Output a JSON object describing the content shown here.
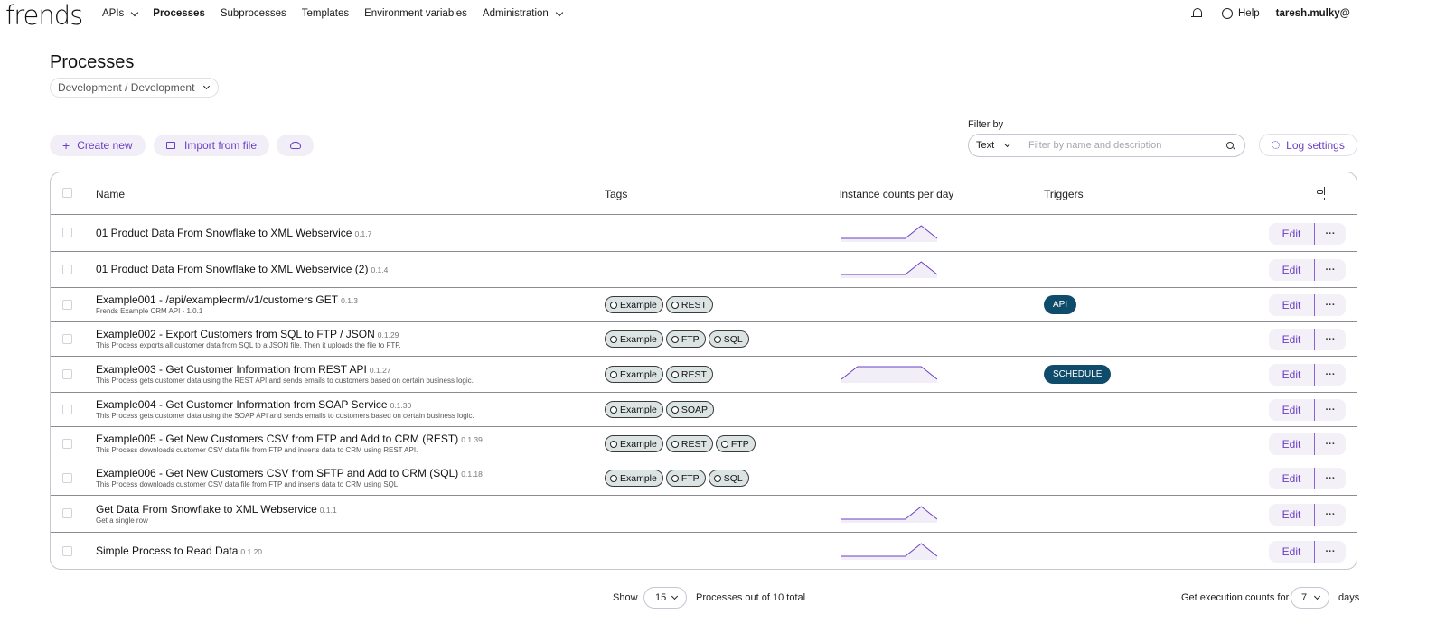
{
  "nav": {
    "logo": "frends",
    "items": [
      {
        "label": "APIs",
        "dropdown": true,
        "active": false
      },
      {
        "label": "Processes",
        "dropdown": false,
        "active": true
      },
      {
        "label": "Subprocesses",
        "dropdown": false,
        "active": false
      },
      {
        "label": "Templates",
        "dropdown": false,
        "active": false
      },
      {
        "label": "Environment variables",
        "dropdown": false,
        "active": false
      },
      {
        "label": "Administration",
        "dropdown": true,
        "active": false
      }
    ],
    "help_label": "Help",
    "user": "taresh.mulky@"
  },
  "page": {
    "title": "Processes",
    "environment": "Development / Development"
  },
  "actions": {
    "create_label": "Create new",
    "import_label": "Import from file"
  },
  "filter": {
    "label": "Filter by",
    "type": "Text",
    "placeholder": "Filter by name and description",
    "log_settings_label": "Log settings"
  },
  "table": {
    "columns": {
      "name": "Name",
      "tags": "Tags",
      "instances": "Instance counts per day",
      "triggers": "Triggers"
    },
    "edit_label": "Edit",
    "more_label": "···",
    "rows": [
      {
        "name": "01 Product Data From Snowflake to XML Webservice",
        "version": "0.1.7",
        "description": "",
        "tags": [],
        "spark": [
          0,
          0,
          0,
          0,
          0,
          1,
          0
        ],
        "trigger": ""
      },
      {
        "name": "01 Product Data From Snowflake to XML Webservice (2)",
        "version": "0.1.4",
        "description": "",
        "tags": [],
        "spark": [
          0,
          0,
          0,
          0,
          0,
          1,
          0
        ],
        "trigger": ""
      },
      {
        "name": "Example001 - /api/examplecrm/v1/customers GET",
        "version": "0.1.3",
        "description": "Frends Example CRM API - 1.0.1",
        "tags": [
          "Example",
          "REST"
        ],
        "spark": [],
        "trigger": "API"
      },
      {
        "name": "Example002 - Export Customers from SQL to FTP / JSON",
        "version": "0.1.29",
        "description": "This Process exports all customer data from SQL to a JSON file. Then it uploads the file to FTP.",
        "tags": [
          "Example",
          "FTP",
          "SQL"
        ],
        "spark": [],
        "trigger": ""
      },
      {
        "name": "Example003 - Get Customer Information from REST API",
        "version": "0.1.27",
        "description": "This Process gets customer data using the REST API and sends emails to customers based on certain business logic.",
        "tags": [
          "Example",
          "REST"
        ],
        "spark": [
          0,
          1,
          1,
          1,
          1,
          1,
          0
        ],
        "trigger": "SCHEDULE"
      },
      {
        "name": "Example004 - Get Customer Information from SOAP Service",
        "version": "0.1.30",
        "description": "This Process gets customer data using the SOAP API and sends emails to customers based on certain business logic.",
        "tags": [
          "Example",
          "SOAP"
        ],
        "spark": [],
        "trigger": ""
      },
      {
        "name": "Example005 - Get New Customers CSV from FTP and Add to CRM (REST)",
        "version": "0.1.39",
        "description": "This Process downloads customer CSV data file from FTP and inserts data to CRM using REST API.",
        "tags": [
          "Example",
          "REST",
          "FTP"
        ],
        "spark": [],
        "trigger": ""
      },
      {
        "name": "Example006 - Get New Customers CSV from SFTP and Add to CRM (SQL)",
        "version": "0.1.18",
        "description": "This Process downloads customer CSV data file from FTP and inserts data to CRM using SQL.",
        "tags": [
          "Example",
          "FTP",
          "SQL"
        ],
        "spark": [],
        "trigger": ""
      },
      {
        "name": "Get Data From Snowflake  to XML Webservice",
        "version": "0.1.1",
        "description": "Get a single row",
        "tags": [],
        "spark": [
          0,
          0,
          0,
          0,
          0,
          1,
          0
        ],
        "trigger": ""
      },
      {
        "name": "Simple Process to Read Data",
        "version": "0.1.20",
        "description": "",
        "tags": [],
        "spark": [
          0,
          0,
          0,
          0,
          0,
          1,
          0
        ],
        "trigger": ""
      }
    ]
  },
  "footer": {
    "show_label": "Show",
    "page_size": "15",
    "count_text": "Processes out of 10 total",
    "exec_label": "Get execution counts for",
    "days_value": "7",
    "days_label": "days"
  },
  "colors": {
    "accent": "#6b3fc4",
    "trigger_bg": "#0f4c6b",
    "spark_line": "#6b3fc4",
    "tag_bg": "#dbe3e3"
  }
}
